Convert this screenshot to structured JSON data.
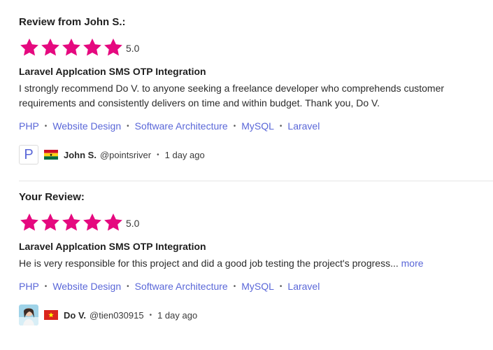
{
  "reviews": [
    {
      "heading": "Review from John S.:",
      "rating": 5,
      "rating_label": "5.0",
      "project_title": "Laravel Applcation SMS OTP Integration",
      "text": "I strongly recommend Do V. to anyone seeking a freelance developer who comprehends customer requirements and consistently delivers on time and within budget. Thank you, Do V.",
      "skills": [
        "PHP",
        "Website Design",
        "Software Architecture",
        "MySQL",
        "Laravel"
      ],
      "author": {
        "avatar_letter": "P",
        "flag": "ghana-flag",
        "name": "John S.",
        "username": "@pointsriver",
        "time": "1 day ago"
      }
    },
    {
      "heading": "Your Review:",
      "rating": 5,
      "rating_label": "5.0",
      "project_title": "Laravel Applcation SMS OTP Integration",
      "text": "He is very responsible for this project and did a good job testing the project's progress...",
      "more_label": "more",
      "skills": [
        "PHP",
        "Website Design",
        "Software Architecture",
        "MySQL",
        "Laravel"
      ],
      "author": {
        "avatar": "user-photo-avatar",
        "flag": "vietnam-flag",
        "name": "Do V.",
        "username": "@tien030915",
        "time": "1 day ago"
      }
    }
  ],
  "colors": {
    "star": "#e5097f",
    "link": "#5a67d8",
    "text": "#1f1f1f",
    "divider": "#e6e6e6"
  }
}
